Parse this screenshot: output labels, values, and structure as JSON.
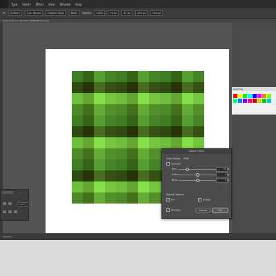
{
  "menu": [
    "Type",
    "Select",
    "Effect",
    "View",
    "Window",
    "Help"
  ],
  "control_bar": {
    "items": [
      "Ps",
      "Uniform",
      "5 pt. Round",
      "Graphic Style",
      "Basic",
      "Opacity",
      "100%"
    ],
    "coord_values": [
      "70 px",
      "47 px",
      "200 px",
      "200 px"
    ]
  },
  "document_tab": "plaid-swatch.ai* @ 200% (RGB/GPU Preview)",
  "status_bar": "Selection",
  "left_panel": {
    "field": "Opacity"
  },
  "swatches_panel": {
    "title": "Swatches",
    "colors": [
      "#ff0000",
      "#ffff00",
      "#00ff00",
      "#00ffff",
      "#0000ff",
      "#ff00ff",
      "#ff8000",
      "#80ff00",
      "#00ff80",
      "#0080ff",
      "#8000ff",
      "#ff0080",
      "#cc0000",
      "#cccc00",
      "#00cc00",
      "#00cccc"
    ]
  },
  "plaid": {
    "background": "#9ad01a",
    "band_colors": [
      "#1f5f2a",
      "#000000",
      "#7fe55a",
      "#3d7a2f"
    ]
  },
  "dialog": {
    "title": "Adjust Colors",
    "color_mode_label": "Color Mode:",
    "color_mode_value": "RGB",
    "convert_label": "Convert",
    "sliders": [
      {
        "label": "Red",
        "value": "-37",
        "unit": "%"
      },
      {
        "label": "Green",
        "value": "0",
        "unit": "%"
      },
      {
        "label": "Blue",
        "value": "0",
        "unit": "%"
      }
    ],
    "adjust_options_label": "Adjust Options",
    "fill_label": "Fill",
    "stroke_label": "Stroke",
    "preview_label": "Preview",
    "cancel_label": "Cancel",
    "ok_label": "OK"
  }
}
